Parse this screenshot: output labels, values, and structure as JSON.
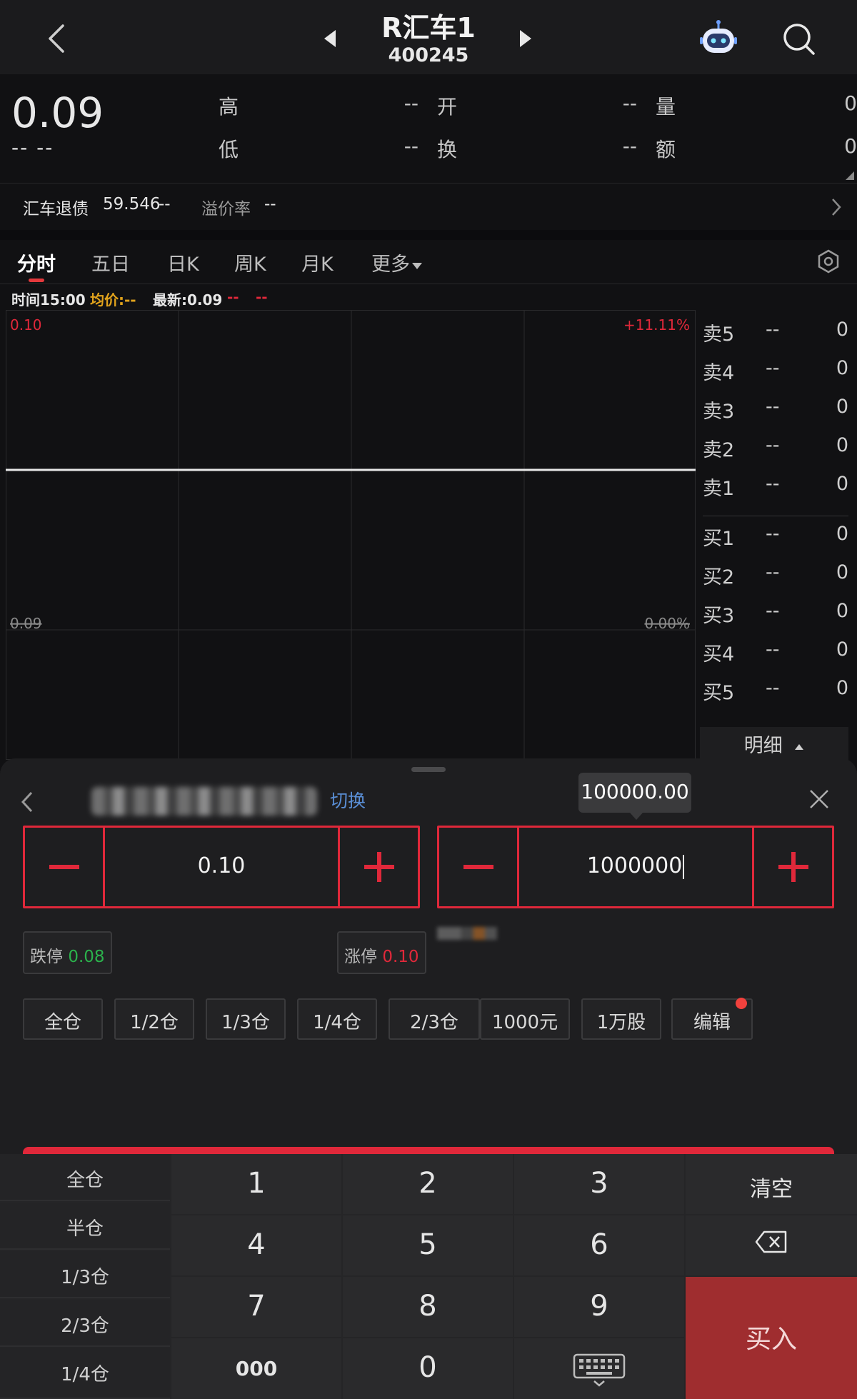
{
  "header": {
    "title": "R汇车1",
    "code": "400245"
  },
  "quote": {
    "price": "0.09",
    "change": "-- --",
    "high_label": "高",
    "high_value": "--",
    "open_label": "开",
    "open_value": "--",
    "volume_label": "量",
    "volume_value": "0",
    "low_label": "低",
    "low_value": "--",
    "turnover_label": "换",
    "turnover_value": "--",
    "amount_label": "额",
    "amount_value": "0"
  },
  "bond": {
    "label": "汇车退债",
    "value": "59.546",
    "value_chg": "--",
    "premium_label": "溢价率",
    "premium_value": "--"
  },
  "tabs": [
    "分时",
    "五日",
    "日K",
    "周K",
    "月K",
    "更多"
  ],
  "chart_info": {
    "time": "时间15:00",
    "avg": "均价:--",
    "latest": "最新:0.09",
    "chg1": "--",
    "chg2": "--"
  },
  "chart_data": {
    "type": "line",
    "title": "",
    "y_left_top": "0.10",
    "y_left_base": "0.09",
    "y_right_top": "+11.11%",
    "y_right_base": "0.00%",
    "ylim": [
      0.08,
      0.1
    ],
    "series": [
      {
        "values": [
          0.09,
          0.09
        ]
      }
    ]
  },
  "orderbook": {
    "sell": [
      {
        "label": "卖5",
        "price": "--",
        "vol": "0"
      },
      {
        "label": "卖4",
        "price": "--",
        "vol": "0"
      },
      {
        "label": "卖3",
        "price": "--",
        "vol": "0"
      },
      {
        "label": "卖2",
        "price": "--",
        "vol": "0"
      },
      {
        "label": "卖1",
        "price": "--",
        "vol": "0"
      }
    ],
    "buy": [
      {
        "label": "买1",
        "price": "--",
        "vol": "0"
      },
      {
        "label": "买2",
        "price": "--",
        "vol": "0"
      },
      {
        "label": "买3",
        "price": "--",
        "vol": "0"
      },
      {
        "label": "买4",
        "price": "--",
        "vol": "0"
      },
      {
        "label": "买5",
        "price": "--",
        "vol": "0"
      }
    ],
    "detail_label": "明细"
  },
  "trade": {
    "switch_label": "切换",
    "qty_tooltip": "100000.00",
    "price_value": "0.10",
    "qty_value": "1000000",
    "limit_down_label": "跌停",
    "limit_down_value": "0.08",
    "limit_up_label": "涨停",
    "limit_up_value": "0.10",
    "position_buttons": [
      "全仓",
      "1/2仓",
      "1/3仓",
      "1/4仓",
      "2/3仓",
      "1000元",
      "1万股",
      "编辑"
    ]
  },
  "keypad": {
    "left": [
      "全仓",
      "半仓",
      "1/3仓",
      "2/3仓",
      "1/4仓"
    ],
    "row1": [
      "1",
      "2",
      "3"
    ],
    "row2": [
      "4",
      "5",
      "6"
    ],
    "row3": [
      "7",
      "8",
      "9"
    ],
    "row4": [
      "000",
      "0"
    ],
    "clear_label": "清空",
    "buy_label": "买入"
  },
  "colors": {
    "red": "#e0283a",
    "green": "#2bb24c",
    "blue_link": "#5a8fd6",
    "avg_orange": "#e0a21c"
  }
}
